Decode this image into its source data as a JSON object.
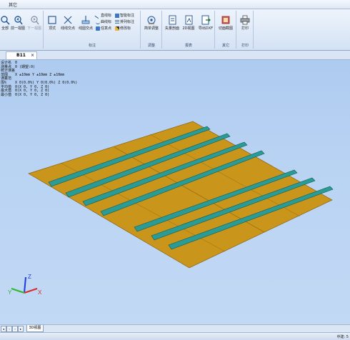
{
  "menubar": {
    "item": "其它"
  },
  "ribbon": {
    "groups": [
      {
        "label": "",
        "buttons": [
          "全部",
          "前一视图",
          "下一视图"
        ]
      },
      {
        "label": "标注",
        "buttons": [
          "顶式",
          "线线交点",
          "线圆交点"
        ],
        "small": [
          "直线标",
          "智能标注",
          "曲线标",
          "排列标注",
          "任意点",
          "修改标"
        ]
      },
      {
        "label": "调整",
        "buttons": [
          "简单调整"
        ]
      },
      {
        "label": "报表",
        "buttons": [
          "矢量剖面",
          "2D视图",
          "导出DXF"
        ]
      },
      {
        "label": "其它",
        "buttons": [
          "切面截图"
        ]
      },
      {
        "label": "打印",
        "buttons": [
          "打印"
        ]
      }
    ]
  },
  "document_tab": {
    "label": "B11",
    "close": "×"
  },
  "info": [
    {
      "label": "设计名",
      "value": "0"
    },
    {
      "label": "测量点",
      "value": "0 (期望:0)"
    },
    {
      "label": "统计误差范围",
      "value": "X ±10mm Y ±10mm Z ±10mm"
    },
    {
      "label": "误差范围%",
      "value": "X 0(0.0%) Y 0(0.0%) Z 0(0.0%)"
    },
    {
      "label": "平均值",
      "value": "0(X 0, Y 0, Z 0)"
    },
    {
      "label": "最大值",
      "value": "0(X 0, Y 0, Z 0)"
    },
    {
      "label": "最小值",
      "value": "0(X 0, Y 0, Z 0)"
    }
  ],
  "axes": {
    "x": "X",
    "y": "Y",
    "z": "Z"
  },
  "bottom_tab": {
    "label": "3D视图"
  },
  "status": {
    "text": "中建: 5"
  }
}
